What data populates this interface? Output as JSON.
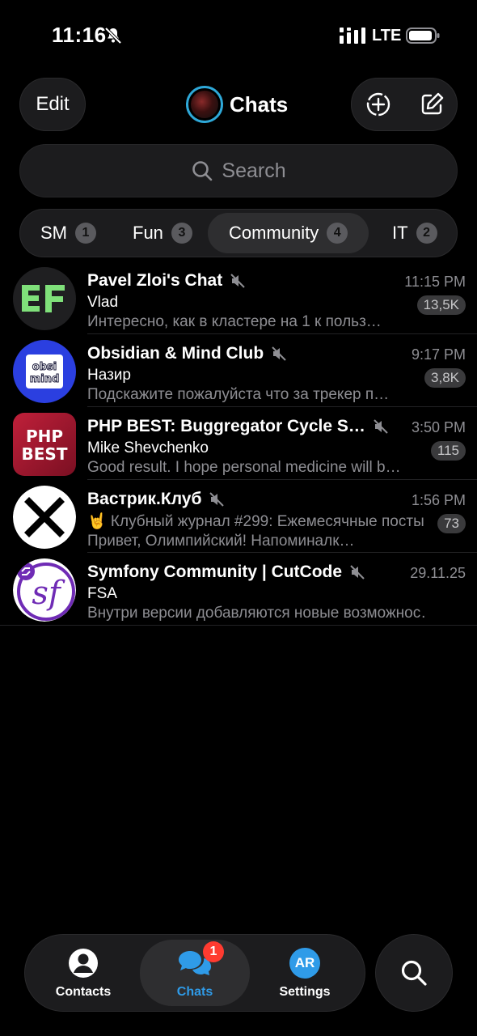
{
  "status_bar": {
    "time": "11:16",
    "network": "LTE",
    "icons": [
      "bell-slash-icon",
      "signal-icon",
      "battery-icon"
    ]
  },
  "header": {
    "edit_label": "Edit",
    "title": "Chats",
    "actions": [
      "add-story-icon",
      "compose-icon"
    ]
  },
  "search": {
    "placeholder": "Search"
  },
  "folders": [
    {
      "label": "SM",
      "count": "1",
      "active": false
    },
    {
      "label": "Fun",
      "count": "3",
      "active": false
    },
    {
      "label": "Community",
      "count": "4",
      "active": true
    },
    {
      "label": "IT",
      "count": "2",
      "active": false
    }
  ],
  "chats": [
    {
      "title": "Pavel Zloi's Chat",
      "muted": true,
      "time": "11:15 PM",
      "sender": "Vlad",
      "preview": "Интересно, как в кластере на 1 к польз…",
      "unread": "13,5K"
    },
    {
      "title": "Obsidian & Mind Club",
      "muted": true,
      "time": "9:17 PM",
      "sender": "Назир",
      "preview": "Подскажите пожалуйста что за трекер п…",
      "unread": "3,8K"
    },
    {
      "title": "PHP BEST: Buggregator Cycle S…",
      "muted": true,
      "time": "3:50 PM",
      "sender": "Mike Shevchenko",
      "preview": "Good result. I hope personal medicine will b…",
      "unread": "115",
      "avatar_text": [
        "PHP",
        "BEST"
      ]
    },
    {
      "title": "Вастрик.Клуб",
      "muted": true,
      "time": "1:56 PM",
      "sender": "",
      "preview": "🤘 Клубный журнал #299: Ежемесячные посты Привет, Олимпийский! Напоминалк…",
      "unread": "73"
    },
    {
      "title": "Symfony Community | CutCode",
      "muted": true,
      "time": "29.11.25",
      "sender": "FSA",
      "preview": "Внутри версии добавляются новые возможнос…",
      "unread": ""
    }
  ],
  "tab_bar": {
    "items": [
      {
        "label": "Contacts",
        "icon": "person-circle-icon"
      },
      {
        "label": "Chats",
        "icon": "chat-bubbles-icon",
        "badge": "1",
        "active": true
      },
      {
        "label": "Settings",
        "icon": "avatar",
        "avatar_initials": "AR"
      }
    ],
    "search_icon": "search-icon"
  },
  "colors": {
    "background": "#000000",
    "surface": "#1c1c1e",
    "accent": "#2f9be8",
    "badge_red": "#ff3b30",
    "secondary_text": "#8e8e93"
  }
}
